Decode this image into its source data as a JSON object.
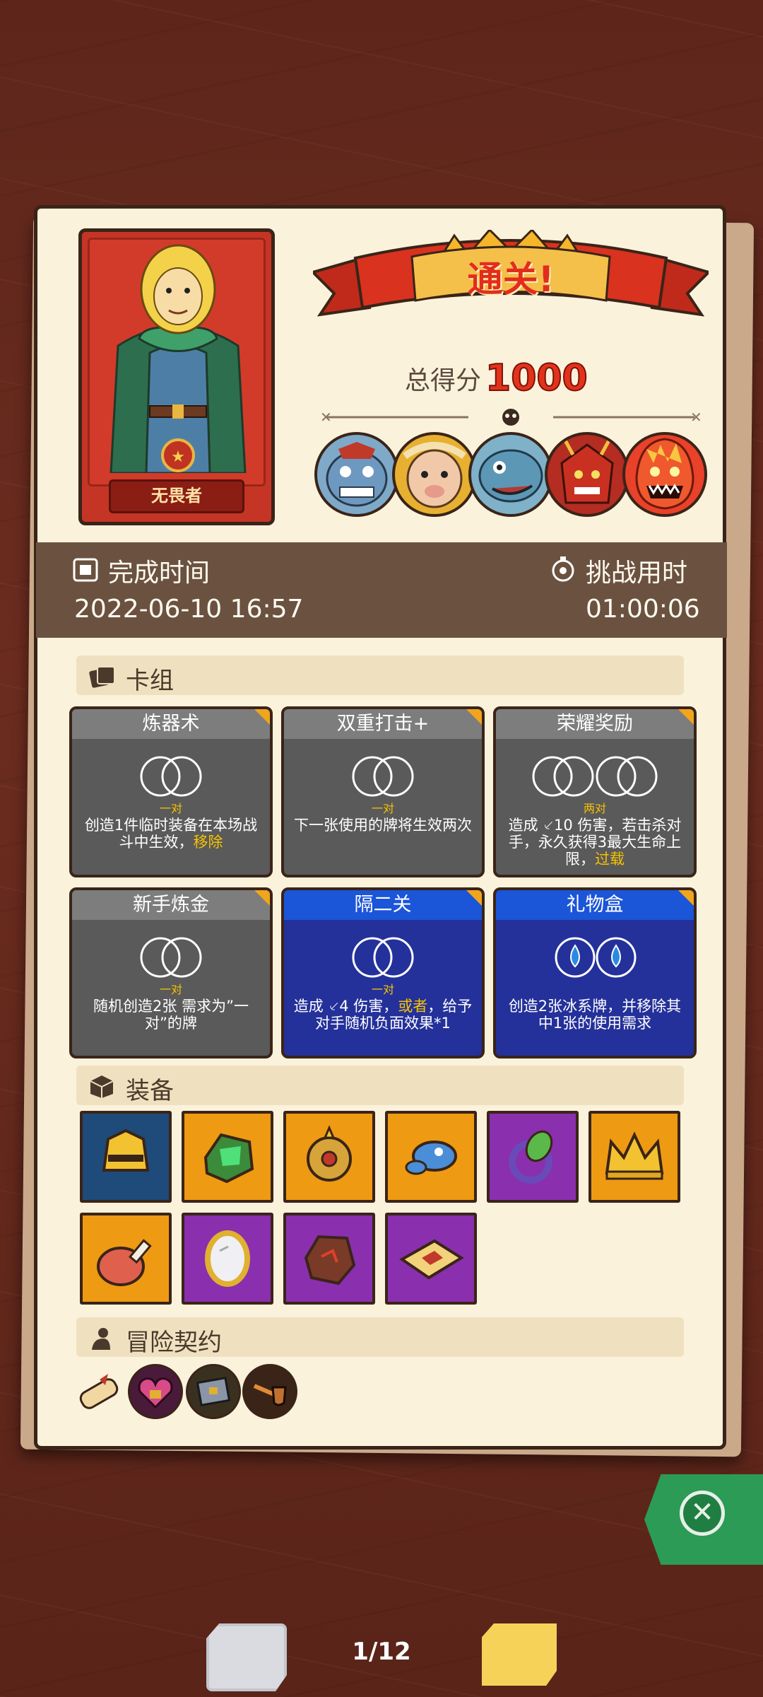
{
  "result": {
    "title": "通关!",
    "score_label": "总得分",
    "score_value": "1000"
  },
  "hero": {
    "name": "无畏者"
  },
  "info": {
    "complete_time_label": "完成时间",
    "complete_time_value": "2022-06-10 16:57",
    "challenge_time_label": "挑战用时",
    "challenge_time_value": "01:00:06"
  },
  "sections": {
    "deck": "卡组",
    "equipment": "装备",
    "contracts": "冒险契约"
  },
  "cards": [
    {
      "name": "炼器术",
      "tag": "一对",
      "desc_a": "创造1件临时装备在本场战斗中生效，",
      "desc_hl": "移除",
      "desc_b": "",
      "style": "gray",
      "requirement": "rings-2"
    },
    {
      "name": "双重打击+",
      "tag": "一对",
      "desc_a": "下一张使用的牌将生效两次",
      "desc_hl": "",
      "desc_b": "",
      "style": "gray",
      "requirement": "rings-2"
    },
    {
      "name": "荣耀奖励",
      "tag": "两对",
      "desc_a": "造成 ⸔10 伤害，若击杀对手，永久获得3最大生命上限，",
      "desc_hl": "过载",
      "desc_b": "",
      "style": "gray",
      "requirement": "rings-4"
    },
    {
      "name": "新手炼金",
      "tag": "一对",
      "desc_a": "随机创造2张 需求为”一对”的牌",
      "desc_hl": "",
      "desc_b": "",
      "style": "gray",
      "requirement": "rings-2"
    },
    {
      "name": "隔二关",
      "tag": "一对",
      "desc_a": "造成 ⸔4 伤害，",
      "desc_hl": "或者",
      "desc_b": "，给予对手随机负面效果*1",
      "style": "blue",
      "requirement": "rings-2"
    },
    {
      "name": "礼物盒",
      "tag": "",
      "desc_a": "创造2张冰系牌，并移除其中1张的使用需求",
      "desc_hl": "",
      "desc_b": "",
      "style": "blue",
      "requirement": "drops-2"
    }
  ],
  "page": {
    "indicator": "1/12"
  },
  "colors": {
    "accent_red": "#e3321c",
    "highlight_yellow": "#f6c300",
    "card_gray": "#5a5a5a",
    "card_blue": "#24319a",
    "info_bar": "#6b5240",
    "close_green": "#2b9b55"
  }
}
